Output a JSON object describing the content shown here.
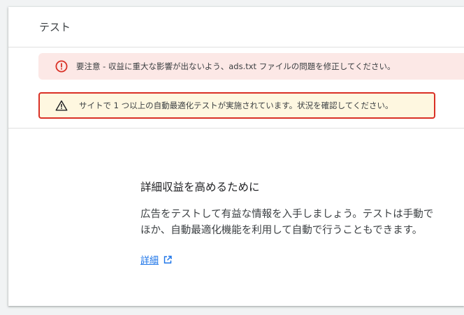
{
  "header": {
    "title": "テスト"
  },
  "banners": {
    "error": {
      "icon": "error-icon",
      "text": "要注意 - 収益に重大な影響が出ないよう、ads.txt ファイルの問題を修正してください。",
      "color": "#d93025"
    },
    "warning": {
      "icon": "warning-icon",
      "text": "サイトで 1 つ以上の自動最適化テストが実施されています。状況を確認してください。",
      "color": "#202124"
    }
  },
  "main": {
    "heading": "詳細収益を高めるために",
    "body_lines": [
      "広告をテストして有益な情報を入手しましょう。テストは手動で",
      "ほか、自動最適化機能を利用して自動で行うこともできます。"
    ],
    "learn_more": {
      "label": "詳細",
      "icon": "open-in-new-icon"
    }
  },
  "colors": {
    "link": "#1a73e8",
    "highlight_border": "#d93025"
  }
}
